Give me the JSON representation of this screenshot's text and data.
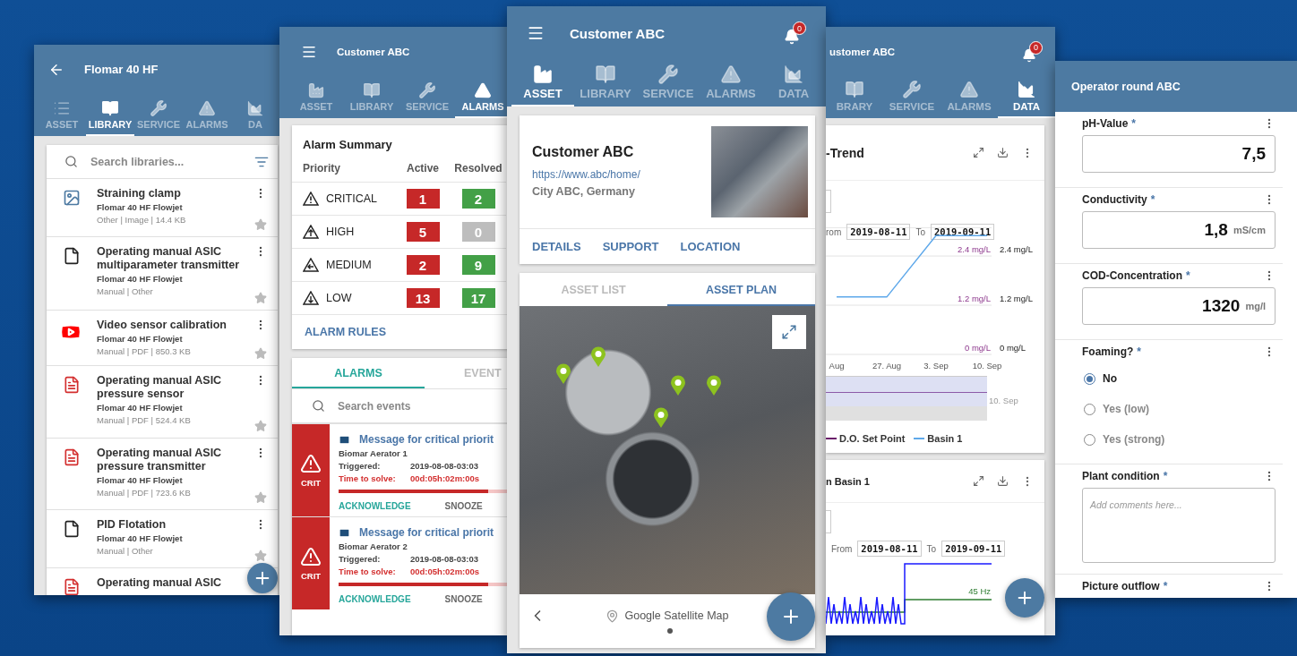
{
  "library_screen": {
    "title": "Flomar 40 HF",
    "tabs": [
      {
        "label": "ASSET",
        "selected": false
      },
      {
        "label": "LIBRARY",
        "selected": true
      },
      {
        "label": "SERVICE",
        "selected": false
      },
      {
        "label": "ALARMS",
        "selected": false
      },
      {
        "label": "DA",
        "selected": false
      }
    ],
    "search": {
      "placeholder": "Search libraries..."
    },
    "items": [
      {
        "kind": "image",
        "title": "Straining clamp",
        "source": "Flomar 40 HF Flowjet",
        "meta": "Other | Image | 14.4 KB",
        "starred": false
      },
      {
        "kind": "document",
        "title": "Operating manual ASIC multiparameter transmitter",
        "source": "Flomar 40 HF Flowjet",
        "meta": "Manual | Other",
        "starred": false
      },
      {
        "kind": "video",
        "title": "Video sensor calibration",
        "source": "Flomar 40 HF Flowjet",
        "meta": "Manual | PDF | 850.3 KB",
        "starred": false
      },
      {
        "kind": "pdf",
        "title": "Operating manual ASIC pressure sensor",
        "source": "Flomar 40 HF Flowjet",
        "meta": "Manual | PDF | 524.4 KB",
        "starred": false
      },
      {
        "kind": "pdf",
        "title": "Operating manual ASIC pressure transmitter",
        "source": "Flomar 40 HF Flowjet",
        "meta": "Manual | PDF | 723.6 KB",
        "starred": false
      },
      {
        "kind": "document",
        "title": "PID Flotation",
        "source": "Flomar 40 HF Flowjet",
        "meta": "Manual | Other",
        "starred": false
      },
      {
        "kind": "pdf",
        "title": "Operating manual ASIC"
      }
    ]
  },
  "alarms_screen": {
    "title": "Customer ABC",
    "tabs": [
      {
        "label": "ASSET",
        "selected": false
      },
      {
        "label": "LIBRARY",
        "selected": false
      },
      {
        "label": "SERVICE",
        "selected": false
      },
      {
        "label": "ALARMS",
        "selected": true
      }
    ],
    "summary": {
      "title": "Alarm Summary",
      "columns": [
        "Priority",
        "Active",
        "Resolved"
      ],
      "rows": [
        {
          "kind": "critical",
          "label": "CRITICAL",
          "active": {
            "value": "1",
            "color": "#c62828"
          },
          "resolved": {
            "value": "2",
            "color": "#43a047"
          }
        },
        {
          "kind": "high",
          "label": "HIGH",
          "active": {
            "value": "5",
            "color": "#c62828"
          },
          "resolved": {
            "value": "0",
            "color": "#bdbdbd"
          }
        },
        {
          "kind": "medium",
          "label": "MEDIUM",
          "active": {
            "value": "2",
            "color": "#c62828"
          },
          "resolved": {
            "value": "9",
            "color": "#43a047"
          }
        },
        {
          "kind": "low",
          "label": "LOW",
          "active": {
            "value": "13",
            "color": "#c62828"
          },
          "resolved": {
            "value": "17",
            "color": "#43a047"
          }
        }
      ],
      "link": "ALARM RULES"
    },
    "list_tabs": [
      {
        "label": "ALARMS",
        "selected": true
      },
      {
        "label": "EVENT",
        "selected": false
      }
    ],
    "search": {
      "placeholder": "Search events"
    },
    "alarms": [
      {
        "badge": "CRIT",
        "title": "Message for critical priorit",
        "device": "Biomar Aerator 1",
        "triggered_label": "Triggered:",
        "triggered": "2019-08-08-03:03",
        "time_label": "Time to solve:",
        "time": "00d:05h:02m:00s",
        "level": 0.88,
        "actions": [
          "ACKNOWLEDGE",
          "SNOOZE"
        ]
      },
      {
        "badge": "CRIT",
        "title": "Message for critical priorit",
        "device": "Biomar Aerator 2",
        "triggered_label": "Triggered:",
        "triggered": "2019-08-08-03:03",
        "time_label": "Time to solve:",
        "time": "00d:05h:02m:00s",
        "level": 0.88,
        "actions": [
          "ACKNOWLEDGE",
          "SNOOZE"
        ]
      }
    ]
  },
  "asset_screen": {
    "title": "Customer ABC",
    "notifications": "0",
    "tabs": [
      {
        "label": "ASSET",
        "selected": true
      },
      {
        "label": "LIBRARY",
        "selected": false
      },
      {
        "label": "SERVICE",
        "selected": false
      },
      {
        "label": "ALARMS",
        "selected": false
      },
      {
        "label": "DATA",
        "selected": false
      }
    ],
    "asset": {
      "name": "Customer ABC",
      "url": "https://www.abc/home/",
      "location": "City ABC, Germany",
      "actions": [
        "DETAILS",
        "SUPPORT",
        "LOCATION"
      ]
    },
    "view_tabs": [
      {
        "label": "ASSET LIST",
        "selected": false
      },
      {
        "label": "ASSET PLAN",
        "selected": true
      }
    ],
    "map": {
      "label": "Google Satellite Map"
    }
  },
  "data_screen": {
    "title": "ustomer ABC",
    "notifications": "0",
    "tabs": [
      {
        "label": "BRARY",
        "selected": false
      },
      {
        "label": "SERVICE",
        "selected": false
      },
      {
        "label": "ALARMS",
        "selected": false
      },
      {
        "label": "DATA",
        "selected": true
      }
    ],
    "trend_card": {
      "title": "-Trend",
      "from_label": "rom",
      "from": "2019-08-11",
      "to_label": "To",
      "to": "2019-09-11",
      "chart_data": {
        "type": "line",
        "categories": [
          "Aug",
          "27. Aug",
          "3. Sep",
          "10. Sep"
        ],
        "series": [
          {
            "name": "Basin 1",
            "color": "#5ea8ea",
            "values": [
              1.4,
              1.4,
              2.9,
              2.9
            ]
          }
        ],
        "ylim": [
          0,
          3.1
        ],
        "yticks": [
          {
            "value": 0,
            "label": "0 mg/L"
          },
          {
            "value": 1.2,
            "label": "1.2 mg/L"
          },
          {
            "value": 2.4,
            "label": "2.4 mg/L"
          }
        ]
      },
      "right_axis": [
        "2.4 mg/L",
        "1.2 mg/L",
        "0 mg/L"
      ],
      "navigator_label": "10. Sep",
      "legend": [
        {
          "label": "D.O. Set Point",
          "color": "#6a1b6a"
        }
      ]
    },
    "basin_card": {
      "title": "n Basin 1",
      "from_label": "From",
      "from": "2019-08-11",
      "to_label": "To",
      "to": "2019-09-11",
      "reading": "45 Hz"
    }
  },
  "form_screen": {
    "title": "Operator round ABC",
    "fields": [
      {
        "kind": "number",
        "label": "pH-Value",
        "mark": "*",
        "value": "7,5"
      },
      {
        "kind": "number",
        "label": "Conductivity",
        "mark": "*",
        "value": "1,8",
        "unit": "mS/cm"
      },
      {
        "kind": "number",
        "label": "COD-Concentration",
        "mark": "*",
        "value": "1320",
        "unit": "mg/l"
      },
      {
        "kind": "choice",
        "label": "Foaming?",
        "mark": "*",
        "options": [
          {
            "label": "No",
            "selected": true
          },
          {
            "label": "Yes (low)",
            "selected": false
          },
          {
            "label": "Yes (strong)",
            "selected": false
          }
        ]
      },
      {
        "kind": "text",
        "label": "Plant condition",
        "mark": "*",
        "placeholder": "Add comments here..."
      },
      {
        "kind": "photo",
        "label": "Picture outflow",
        "mark": "*"
      }
    ]
  }
}
